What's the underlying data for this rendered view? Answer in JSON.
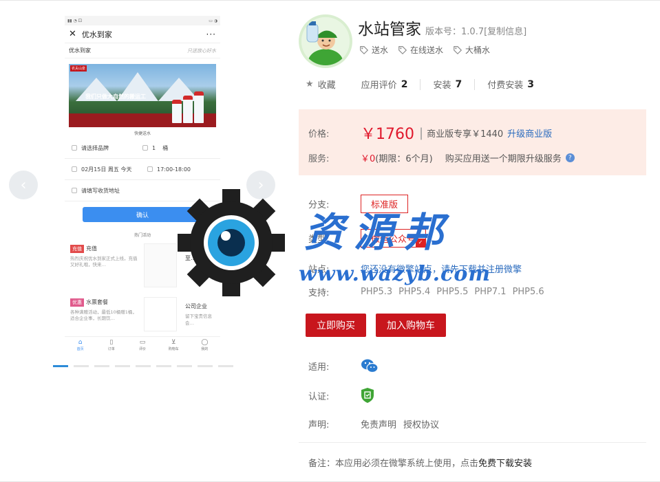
{
  "gallery": {
    "prev_icon": "chevron-left-icon",
    "next_icon": "chevron-right-icon",
    "phone": {
      "title": "优水到家",
      "brand": "优水到家",
      "slogan": "只送放心好水",
      "banner_logo": "农夫山泉",
      "banner_text": "我们只做大自然的搬运工",
      "quick_title": "快捷送水",
      "select_brand": "请选择品牌",
      "qty": "1",
      "unit": "桶",
      "date": "02月15日 周五 今天",
      "time": "17:00-18:00",
      "address": "请填写收货地址",
      "confirm": "确认",
      "hot_title": "热门活动",
      "promo1_tag": "充值",
      "promo1_title": "充值",
      "promo1_desc": "热烈庆祝优水到家正式上线，充值又好礼哦，快来…",
      "promo2_title": "至…金",
      "promo3_tag": "优惠",
      "promo3_title": "水票套餐",
      "promo3_desc": "各种满赠活动，最低10桶赠1桶，适合企业事，长期饮…",
      "promo4_title": "公司企业",
      "promo4_desc": "留下宝贵信息会…",
      "tabs": [
        {
          "label": "首页",
          "icon": "home-icon"
        },
        {
          "label": "订单",
          "icon": "order-icon"
        },
        {
          "label": "评价",
          "icon": "comment-icon"
        },
        {
          "label": "购物车",
          "icon": "cart-icon"
        },
        {
          "label": "我的",
          "icon": "user-icon"
        }
      ]
    },
    "dots_count": 9,
    "active_dot": 0
  },
  "app": {
    "name": "水站管家",
    "version_label": "版本号：",
    "version": "1.0.7",
    "copy": "[复制信息]",
    "tags": [
      "送水",
      "在线送水",
      "大桶水"
    ],
    "collect": "收藏",
    "reviews_label": "应用评价",
    "reviews": "2",
    "installs_label": "安装",
    "installs": "7",
    "paid_label": "付费安装",
    "paid": "3"
  },
  "pricing": {
    "price_label": "价格:",
    "price": "￥1760",
    "sep": "|",
    "biz_price": "商业版专享￥1440",
    "upgrade": "升级商业版",
    "service_label": "服务:",
    "service_price": "￥0",
    "service_period": "(期限：6个月)",
    "service_note": "购买应用送一个期限升级服务"
  },
  "specs": {
    "branch_label": "分支:",
    "branch": "标准版",
    "type_label": "类型:",
    "type": "微信公众号",
    "site_label": "站点:",
    "site": "您还没有微擎站点，请先下载并注册微擎",
    "support_label": "支持:",
    "php": [
      "PHP5.3",
      "PHP5.4",
      "PHP5.5",
      "PHP7.1",
      "PHP5.6"
    ],
    "buy": "立即购买",
    "cart": "加入购物车",
    "apply_label": "适用:",
    "cert_label": "认证:",
    "statement_label": "声明:",
    "disclaimer": "免责声明",
    "license": "授权协议",
    "note_prefix": "备注：本应用必须在微擎系统上使用，点击",
    "note_link": "免费下载安装"
  },
  "watermark": {
    "text": "资源邦",
    "url": "www.wazyb.com"
  },
  "colors": {
    "accent_red": "#c8161d",
    "price_red": "#e0182c",
    "link_blue": "#2a6bbe",
    "price_bg": "#fdece6",
    "watermark_blue": "#2a6fd0"
  }
}
